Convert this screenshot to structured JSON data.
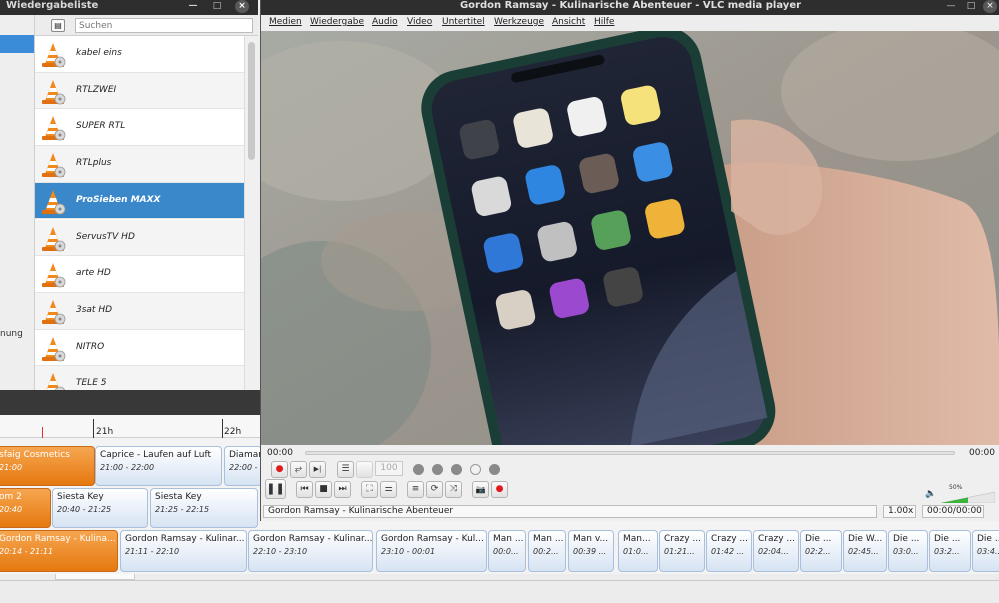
{
  "playlist": {
    "title": "Wiedergabeliste",
    "left_label": "nung",
    "search_placeholder": "Suchen",
    "items": [
      {
        "name": "kabel eins"
      },
      {
        "name": "RTLZWEI"
      },
      {
        "name": "SUPER RTL"
      },
      {
        "name": "RTLplus"
      },
      {
        "name": "ProSieben MAXX",
        "selected": true
      },
      {
        "name": "ServusTV HD"
      },
      {
        "name": "arte HD"
      },
      {
        "name": "3sat HD"
      },
      {
        "name": "NITRO"
      },
      {
        "name": "TELE 5"
      }
    ]
  },
  "window_buttons": {
    "minimize": "—",
    "maximize": "□",
    "close": "×"
  },
  "epg": {
    "time_labels": [
      "21h",
      "22h"
    ],
    "rows": [
      [
        {
          "title": "sfaig Cosmetics",
          "time": "21:00",
          "current": true
        },
        {
          "title": "Caprice - Laufen auf Luft",
          "time": "21:00 - 22:00"
        },
        {
          "title": "Diamar",
          "time": "22:00 -"
        }
      ],
      [
        {
          "title": "om 2",
          "time": "20:40",
          "current": true
        },
        {
          "title": "Siesta Key",
          "time": "20:40 - 21:25"
        },
        {
          "title": "Siesta Key",
          "time": "21:25 - 22:15"
        }
      ],
      [
        {
          "title": "Gordon Ramsay - Kulina...",
          "time": "20:14 - 21:11",
          "current": true
        },
        {
          "title": "Gordon Ramsay - Kulinar...",
          "time": "21:11 - 22:10"
        },
        {
          "title": "Gordon Ramsay - Kulinar...",
          "time": "22:10 - 23:10"
        },
        {
          "title": "Gordon Ramsay - Kul...",
          "time": "23:10 - 00:01"
        },
        {
          "title": "Man ...",
          "time": "00:0..."
        },
        {
          "title": "Man ...",
          "time": "00:2..."
        },
        {
          "title": "Man v...",
          "time": "00:39 ..."
        },
        {
          "title": "Man...",
          "time": "01:0..."
        },
        {
          "title": "Crazy ...",
          "time": "01:21..."
        },
        {
          "title": "Crazy ...",
          "time": "01:42 ..."
        },
        {
          "title": "Crazy ...",
          "time": "02:04..."
        },
        {
          "title": "Die ...",
          "time": "02:2..."
        },
        {
          "title": "Die W...",
          "time": "02:45..."
        },
        {
          "title": "Die ...",
          "time": "03:0..."
        },
        {
          "title": "Die ...",
          "time": "03:2..."
        },
        {
          "title": "Die ...",
          "time": "03:4..."
        }
      ]
    ]
  },
  "vlc": {
    "title": "Gordon Ramsay - Kulinarische Abenteuer - VLC media player",
    "menu": [
      "Medien",
      "Wiedergabe",
      "Audio",
      "Video",
      "Untertitel",
      "Werkzeuge",
      "Ansicht",
      "Hilfe"
    ],
    "elapsed": "00:00",
    "remaining": "00:00",
    "speed_field": "100",
    "volume_label": "50%",
    "volume_level": 0.5,
    "status_title": "Gordon Ramsay - Kulinarische Abenteuer",
    "status_speed": "1.00x",
    "status_time": "00:00/00:00",
    "icons": {
      "record": "●",
      "loop_ab": "⥂",
      "frame_step": "▶|",
      "playlist": "☰",
      "pause": "❚❚",
      "prev": "⏮",
      "stop": "■",
      "next": "⏭",
      "fullscreen": "⛶",
      "ext_settings": "⚌",
      "toggle_playlist": "≡",
      "loop": "⟳",
      "shuffle": "⤨",
      "snapshot": "📷",
      "volume": "🔈"
    },
    "colors": {
      "accent": "#3a87c9",
      "record": "#e01b1b",
      "current_program": "#e5780f"
    }
  }
}
